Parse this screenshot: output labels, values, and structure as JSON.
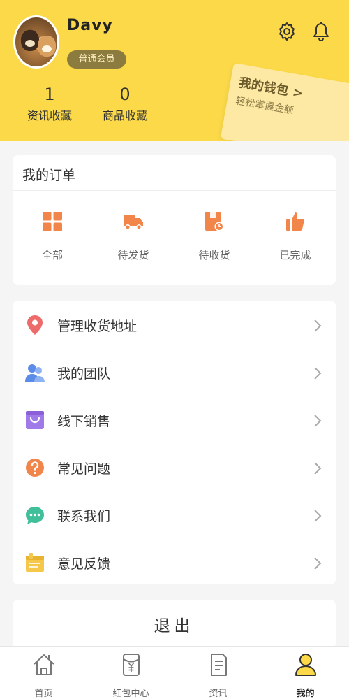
{
  "profile": {
    "username": "Davy",
    "member_level": "普通会员"
  },
  "stats": [
    {
      "value": "1",
      "label": "资讯收藏"
    },
    {
      "value": "0",
      "label": "商品收藏"
    }
  ],
  "wallet": {
    "title": "我的钱包 >",
    "subtitle": "轻松掌握金额"
  },
  "orders": {
    "title": "我的订单",
    "items": [
      {
        "label": "全部",
        "icon": "grid-icon"
      },
      {
        "label": "待发货",
        "icon": "truck-icon"
      },
      {
        "label": "待收货",
        "icon": "package-clock-icon"
      },
      {
        "label": "已完成",
        "icon": "thumbs-up-icon"
      }
    ]
  },
  "menu": [
    {
      "label": "管理收货地址",
      "icon": "location-pin-icon"
    },
    {
      "label": "我的团队",
      "icon": "team-icon"
    },
    {
      "label": "线下销售",
      "icon": "shopping-bag-icon"
    },
    {
      "label": "常见问题",
      "icon": "question-icon"
    },
    {
      "label": "联系我们",
      "icon": "chat-bubble-icon"
    },
    {
      "label": "意见反馈",
      "icon": "feedback-icon"
    }
  ],
  "logout": {
    "label": "退出"
  },
  "tabbar": [
    {
      "label": "首页",
      "icon": "home-icon"
    },
    {
      "label": "红包中心",
      "icon": "red-packet-icon"
    },
    {
      "label": "资讯",
      "icon": "news-icon"
    },
    {
      "label": "我的",
      "icon": "user-icon",
      "active": true
    }
  ],
  "colors": {
    "brand_yellow": "#fbd949",
    "order_orange": "#f2864a",
    "active_tab": "#fbd949"
  }
}
